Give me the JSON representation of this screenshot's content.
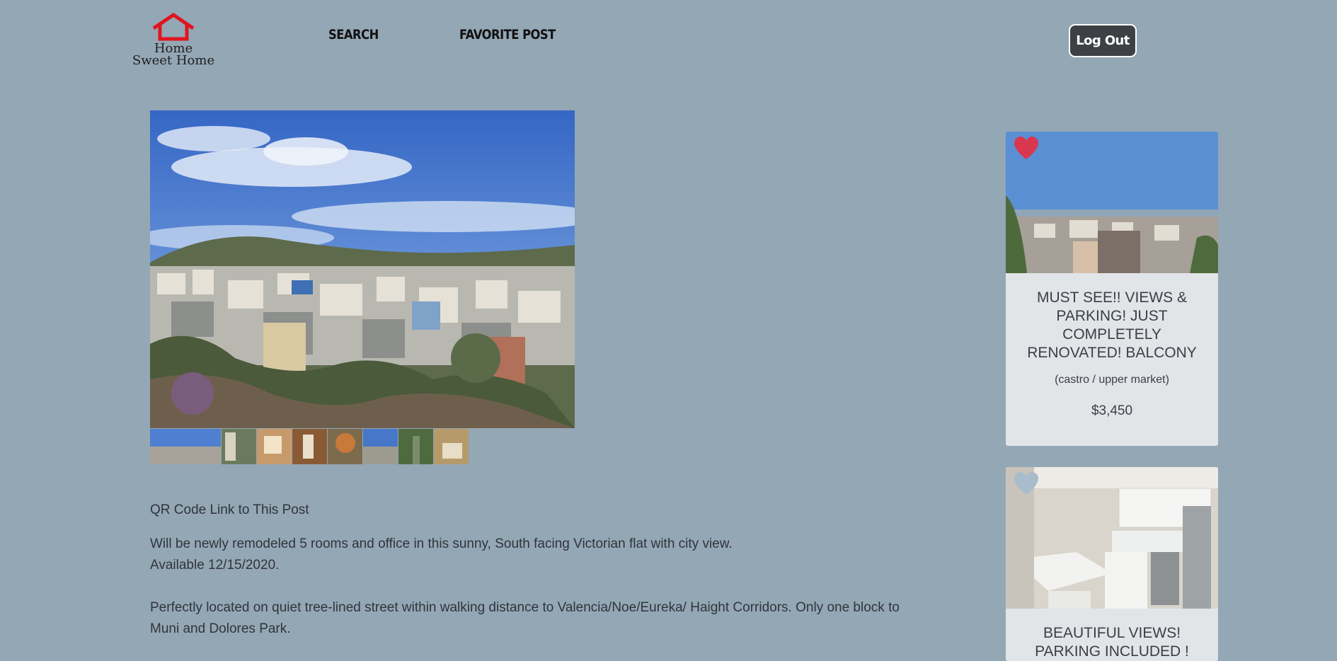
{
  "header": {
    "logo_line1": "Home",
    "logo_line2": "Sweet Home",
    "nav": [
      {
        "label": "SEARCH"
      },
      {
        "label": "FAVORITE POST"
      }
    ],
    "logout_label": "Log Out"
  },
  "post": {
    "qr_link": "QR Code Link to This Post",
    "description": [
      "Will be newly remodeled 5 rooms and office in this sunny, South facing Victorian flat with city view.",
      "Available 12/15/2020.",
      "Perfectly located on quiet tree-lined street within walking distance to Valencia/Noe/Eureka/ Haight Corridors. Only one block to Muni and Dolores Park."
    ],
    "thumbnail_count": 9
  },
  "sidebar": {
    "cards": [
      {
        "title": "MUST SEE!! VIEWS & PARKING! JUST COMPLETELY RENOVATED! BALCONY",
        "location": "(castro / upper market)",
        "price": "$3,450",
        "favorited": true,
        "heart_color": "#d9374f"
      },
      {
        "title": "BEAUTIFUL VIEWS! PARKING INCLUDED !",
        "favorited": false,
        "heart_color": "#a9bccb"
      }
    ]
  },
  "colors": {
    "background": "#94a7b5",
    "logo_red": "#e0151f",
    "button_dark": "#3d4145",
    "card_bg": "#e2e5e8"
  }
}
